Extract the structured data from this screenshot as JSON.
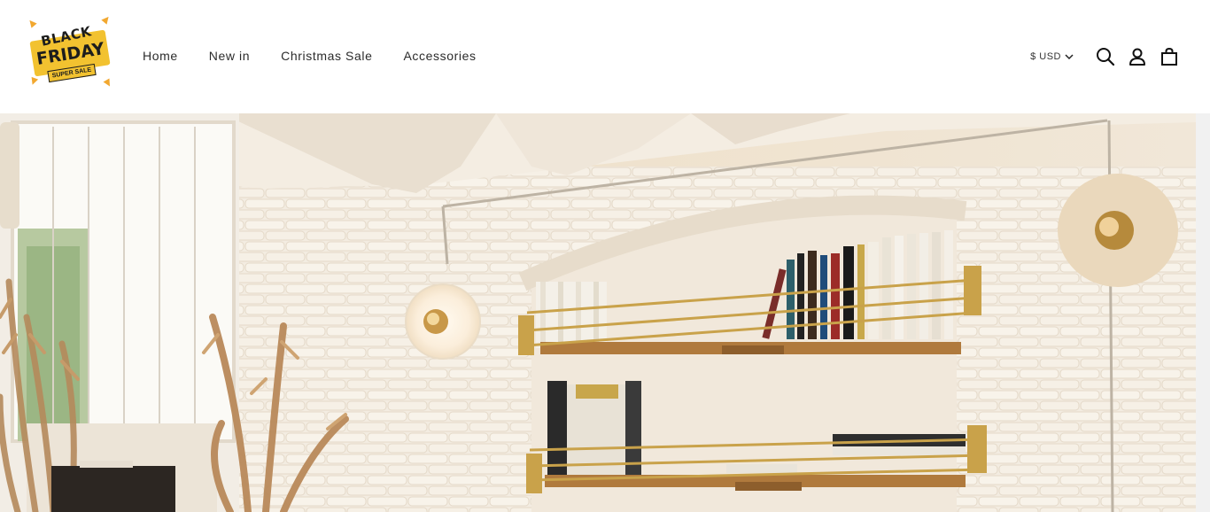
{
  "logo": {
    "line1": "BLACK",
    "line2": "FRIDAY",
    "ribbon": "SUPER SALE"
  },
  "nav": {
    "items": [
      {
        "label": "Home"
      },
      {
        "label": "New in"
      },
      {
        "label": "Christmas Sale"
      },
      {
        "label": "Accessories"
      }
    ]
  },
  "utils": {
    "currency": "$ USD",
    "icons": [
      "search-icon",
      "account-icon",
      "cart-icon"
    ]
  },
  "hero": {
    "image": "interior-room-photo"
  },
  "colors": {
    "logo_yellow": "#f2c230",
    "text": "#2b2b2b",
    "brick": "#f3ece1",
    "wood": "#b07a3d",
    "brass": "#c9a24a"
  }
}
